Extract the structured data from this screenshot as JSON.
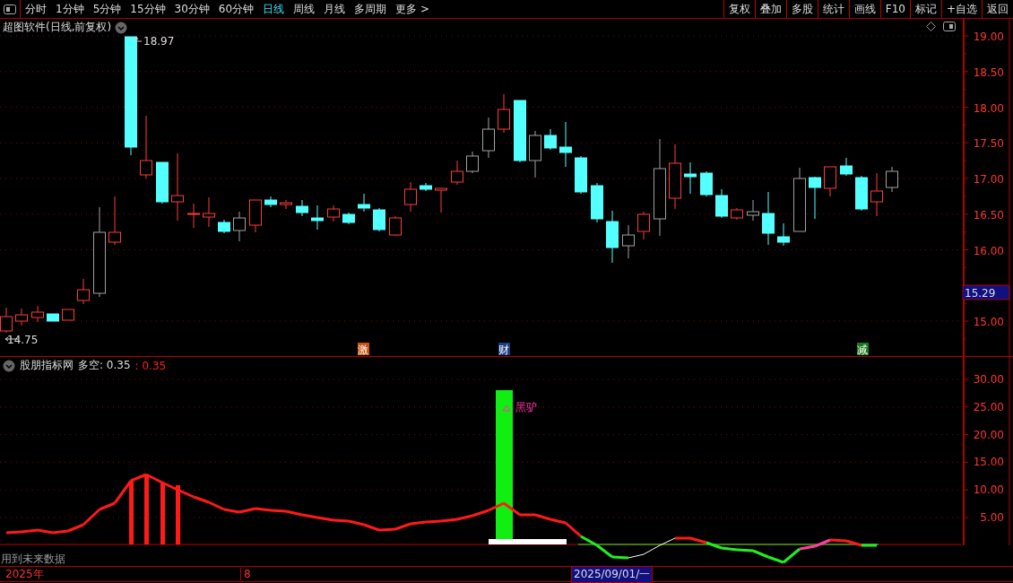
{
  "toolbar": {
    "periods": [
      {
        "label": "分时",
        "selected": false
      },
      {
        "label": "1分钟",
        "selected": false
      },
      {
        "label": "5分钟",
        "selected": false
      },
      {
        "label": "15分钟",
        "selected": false
      },
      {
        "label": "30分钟",
        "selected": false
      },
      {
        "label": "60分钟",
        "selected": false
      },
      {
        "label": "日线",
        "selected": true
      },
      {
        "label": "周线",
        "selected": false
      },
      {
        "label": "月线",
        "selected": false
      },
      {
        "label": "多周期",
        "selected": false
      },
      {
        "label": "更多 >",
        "selected": false
      }
    ],
    "actions": [
      "复权",
      "叠加",
      "多股",
      "统计",
      "画线",
      "F10",
      "标记",
      "+自选",
      "返回"
    ]
  },
  "main_chart": {
    "title": "超图软件(日线,前复权)",
    "high_label": "18.97",
    "low_label": "14.75",
    "price_axis": [
      "19.00",
      "18.50",
      "18.00",
      "17.50",
      "17.00",
      "16.50",
      "16.00",
      "15.00"
    ],
    "current_price": "15.29",
    "event_markers": [
      {
        "label": "激",
        "color": "#c8500f"
      },
      {
        "label": "财",
        "color": "#1b3c82"
      },
      {
        "label": "减",
        "color": "#1c7a1c"
      }
    ]
  },
  "indicator": {
    "name": "股朋指标网",
    "label": "多空: 0.35",
    "value": ": 0.35",
    "axis": [
      "30.00",
      "25.00",
      "20.00",
      "15.00",
      "10.00",
      "5.00"
    ],
    "signal_label": "黑驴",
    "note": "用到未来数据"
  },
  "timeline": {
    "year": "2025年",
    "month": "8",
    "cursor_date": "2025/09/01/一"
  }
}
